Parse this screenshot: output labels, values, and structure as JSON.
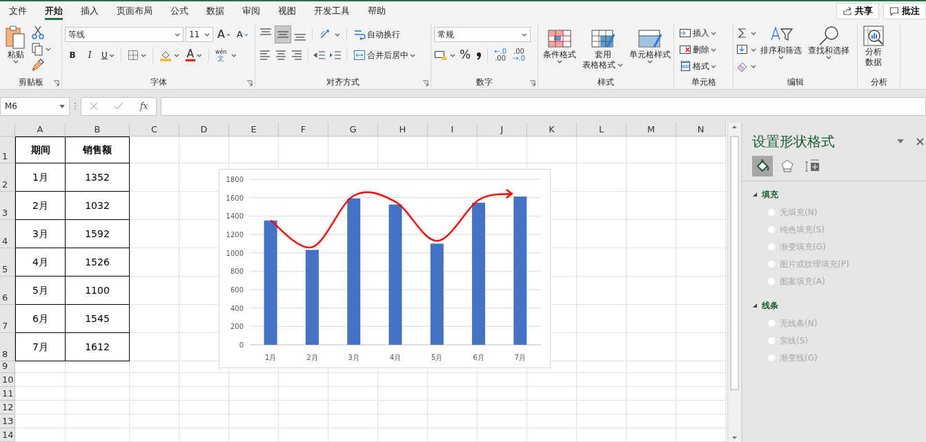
{
  "menu_tabs": [
    {
      "label": "文件",
      "selected": false
    },
    {
      "label": "开始",
      "selected": true
    },
    {
      "label": "插入",
      "selected": false
    },
    {
      "label": "页面布局",
      "selected": false
    },
    {
      "label": "公式",
      "selected": false
    },
    {
      "label": "数据",
      "selected": false
    },
    {
      "label": "审阅",
      "selected": false
    },
    {
      "label": "视图",
      "selected": false
    },
    {
      "label": "开发工具",
      "selected": false
    },
    {
      "label": "帮助",
      "selected": false
    }
  ],
  "top_buttons": [
    "共享",
    "批注"
  ],
  "ribbon": {
    "clipboard": {
      "paste": "粘贴",
      "label": "剪贴板"
    },
    "font": {
      "font_name": "等线",
      "font_size": "11",
      "grow": "A",
      "shrink": "A",
      "bold": "B",
      "italic": "I",
      "underline": "U",
      "font_color": "A",
      "phonetic_top": "wén",
      "phonetic_bottom": "文",
      "label": "字体"
    },
    "alignment": {
      "vertical_align": [
        {
          "selected": false
        },
        {
          "selected": true
        },
        {
          "selected": false
        }
      ],
      "wrap_text": "自动换行",
      "merge_center": "合并后居中",
      "label": "对齐方式"
    },
    "number": {
      "format": "常规",
      "percent": "%",
      "increase_decimal": [
        "←.0",
        ".00"
      ],
      "decrease_decimal": [
        ".00",
        "→.0"
      ],
      "label": "数字"
    },
    "styles": {
      "buttons": [
        {
          "lines": [
            "条件格式"
          ]
        },
        {
          "lines": [
            "套用",
            "表格格式"
          ]
        },
        {
          "lines": [
            "单元格样式"
          ]
        }
      ],
      "label": "样式"
    },
    "cells": {
      "buttons": [
        "插入",
        "删除",
        "格式"
      ],
      "label": "单元格"
    },
    "editing": {
      "buttons": [
        "排序和筛选",
        "查找和选择"
      ],
      "label": "编辑"
    },
    "analysis": {
      "button": [
        "分析",
        "数据"
      ],
      "label": "分析"
    }
  },
  "name_box": "M6",
  "formula_fx": "fx",
  "sheet": {
    "columns": [
      "A",
      "B",
      "C",
      "D",
      "E",
      "F",
      "G",
      "H",
      "I",
      "J",
      "K",
      "L",
      "M",
      "N"
    ],
    "row_numbers": [
      "1",
      "2",
      "3",
      "4",
      "5",
      "6",
      "7",
      "8",
      "9",
      "10",
      "11",
      "12",
      "13",
      "14"
    ],
    "cells": [
      [
        "期间",
        "销售额"
      ],
      [
        "1月",
        "1352"
      ],
      [
        "2月",
        "1032"
      ],
      [
        "3月",
        "1592"
      ],
      [
        "4月",
        "1526"
      ],
      [
        "5月",
        "1100"
      ],
      [
        "6月",
        "1545"
      ],
      [
        "7月",
        "1612"
      ]
    ]
  },
  "chart": {
    "chart_data": {
      "type": "bar",
      "categories": [
        "1月",
        "2月",
        "3月",
        "4月",
        "5月",
        "6月",
        "7月"
      ],
      "series": [
        {
          "color": "#4472c4",
          "values": [
            1352,
            1032,
            1592,
            1526,
            1100,
            1545,
            1612
          ]
        }
      ],
      "ylim": [
        0,
        1800
      ],
      "yticks": [
        0,
        200,
        400,
        600,
        800,
        1000,
        1200,
        1400,
        1600,
        1800
      ],
      "grid": true
    }
  },
  "pane": {
    "title": "设置形状格式",
    "tabs": [
      {
        "selected": true
      },
      {
        "selected": false
      },
      {
        "selected": false
      }
    ],
    "sections": [
      {
        "title": "填充",
        "expanded": true,
        "options": [
          {
            "label": "无填充(N)",
            "selected": false,
            "disabled": true
          },
          {
            "label": "纯色填充(S)",
            "selected": false,
            "disabled": true
          },
          {
            "label": "渐变填充(G)",
            "selected": false,
            "disabled": true
          },
          {
            "label": "图片或纹理填充(P)",
            "selected": false,
            "disabled": true
          },
          {
            "label": "图案填充(A)",
            "selected": false,
            "disabled": true
          }
        ]
      },
      {
        "title": "线条",
        "expanded": true,
        "options": [
          {
            "label": "无线条(N)",
            "selected": false,
            "disabled": true
          },
          {
            "label": "实线(S)",
            "selected": false,
            "disabled": true
          },
          {
            "label": "渐变线(G)",
            "selected": false,
            "disabled": true
          }
        ]
      }
    ]
  }
}
